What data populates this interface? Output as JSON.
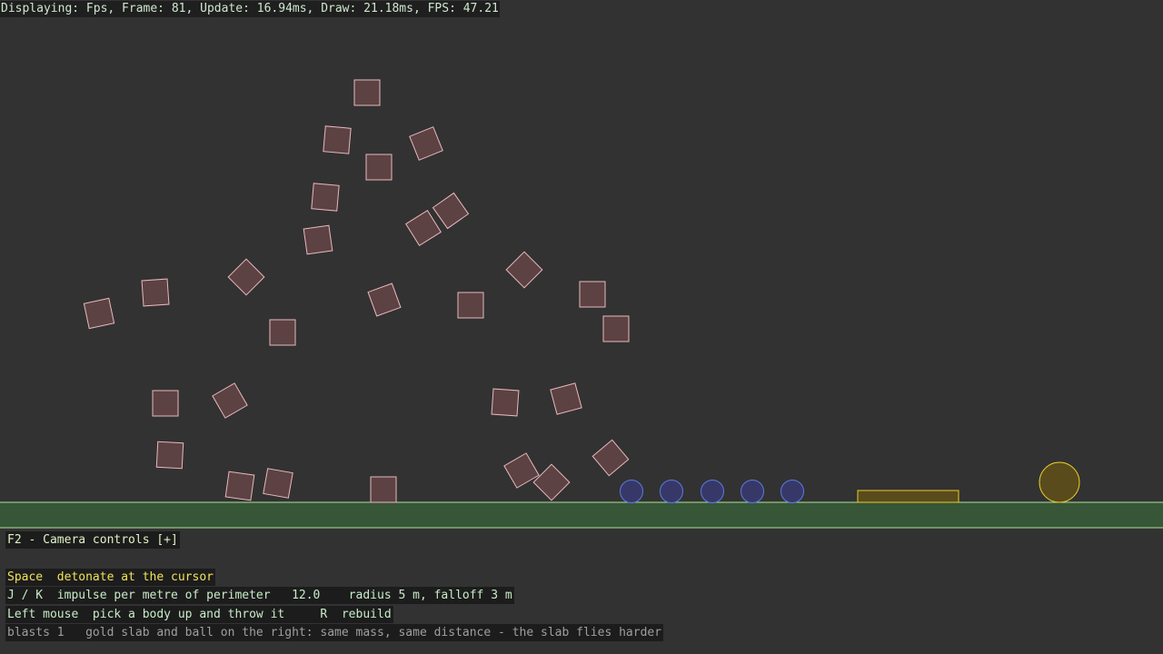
{
  "status_line": "Displaying: Fps, Frame: 81, Update: 16.94ms, Draw: 21.18ms, FPS: 47.21",
  "panel": {
    "camera_controls": "F2 - Camera controls [+]",
    "space_hint": "Space  detonate at the cursor",
    "impulse_hint": "J / K  impulse per metre of perimeter   12.0    radius 5 m, falloff 3 m",
    "mouse_hint": "Left mouse  pick a body up and throw it     R  rebuild",
    "blasts_note": "blasts 1   gold slab and ball on the right: same mass, same distance - the slab flies harder"
  },
  "colors": {
    "background": "#323232",
    "ground_fill": "#375637",
    "ground_edge": "#a9e39a",
    "box_fill": "#5c4242",
    "box_stroke": "#e8b8c0",
    "ball_fill": "#383868",
    "ball_stroke": "#5a7ae6",
    "gold_fill": "#5a4b1c",
    "gold_stroke": "#e8cc2a"
  }
}
